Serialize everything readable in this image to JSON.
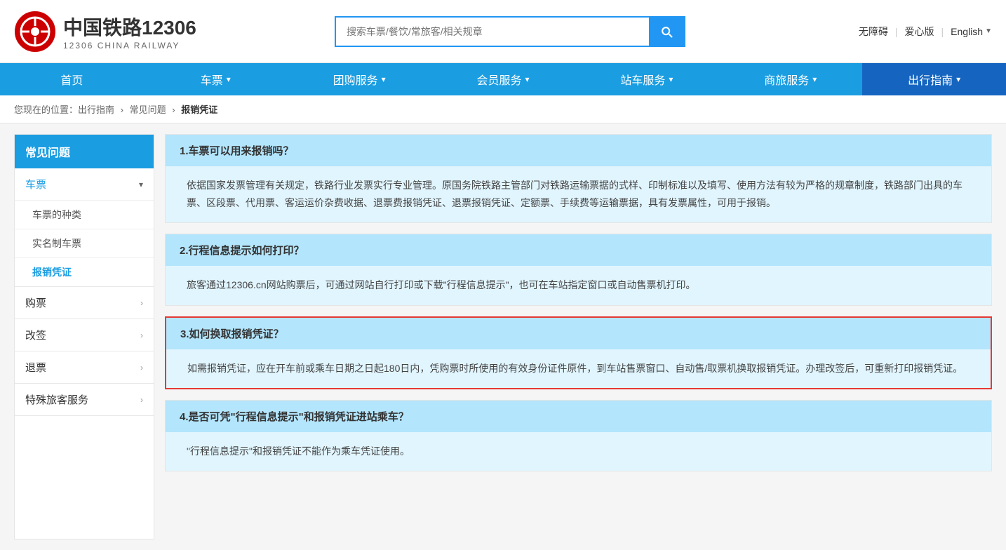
{
  "header": {
    "logo_title": "中国铁路12306",
    "logo_subtitle": "12306 CHINA RAILWAY",
    "search_placeholder": "搜索车票/餐饮/常旅客/相关规章",
    "links": {
      "accessibility": "无障碍",
      "care": "爱心版",
      "language": "English"
    }
  },
  "nav": {
    "items": [
      {
        "label": "首页",
        "has_arrow": false
      },
      {
        "label": "车票",
        "has_arrow": true
      },
      {
        "label": "团购服务",
        "has_arrow": true
      },
      {
        "label": "会员服务",
        "has_arrow": true
      },
      {
        "label": "站车服务",
        "has_arrow": true
      },
      {
        "label": "商旅服务",
        "has_arrow": true
      },
      {
        "label": "出行指南",
        "has_arrow": true
      }
    ]
  },
  "breadcrumb": {
    "items": [
      "您现在的位置：出行指南",
      "常见问题",
      "报销凭证"
    ]
  },
  "sidebar": {
    "title": "常见问题",
    "sections": [
      {
        "label": "车票",
        "expanded": true,
        "sub_items": [
          "车票的种类",
          "实名制车票",
          "报销凭证"
        ]
      },
      {
        "label": "购票",
        "expanded": false
      },
      {
        "label": "改签",
        "expanded": false
      },
      {
        "label": "退票",
        "expanded": false
      },
      {
        "label": "特殊旅客服务",
        "expanded": false
      }
    ]
  },
  "faqs": [
    {
      "id": 1,
      "title": "1.车票可以用来报销吗？",
      "body": "依据国家发票管理有关规定，铁路行业发票实行专业管理。原国务院铁路主管部门对铁路运输票据的式样、印制标准以及填写、使用方法有较为严格的规章制度，铁路部门出具的车票、区段票、代用票、客运运价杂费收据、退票费报销凭证、退票报销凭证、定额票、手续费等运输票据，具有发票属性，可用于报销。",
      "highlighted": false
    },
    {
      "id": 2,
      "title": "2.行程信息提示如何打印？",
      "body": "旅客通过12306.cn网站购票后，可通过网站自行打印或下载\"行程信息提示\"，也可在车站指定窗口或自动售票机打印。",
      "highlighted": false
    },
    {
      "id": 3,
      "title": "3.如何换取报销凭证？",
      "body": "如需报销凭证，应在开车前或乘车日期之日起180日内，凭购票时所使用的有效身份证件原件，到车站售票窗口、自动售/取票机换取报销凭证。办理改签后，可重新打印报销凭证。",
      "highlighted": true
    },
    {
      "id": 4,
      "title": "4.是否可凭\"行程信息提示\"和报销凭证进站乘车？",
      "body": "\"行程信息提示\"和报销凭证不能作为乘车凭证使用。",
      "highlighted": false
    }
  ]
}
